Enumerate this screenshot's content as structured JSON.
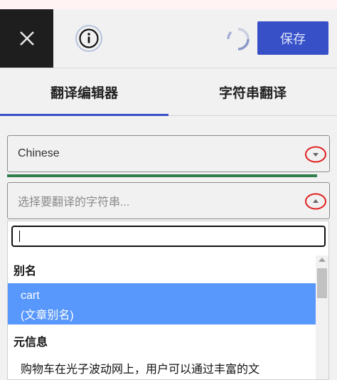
{
  "header": {
    "close_icon": "close-icon",
    "info_icon": "info-icon",
    "spinner_icon": "loading-spinner-icon",
    "save_label": "保存"
  },
  "tabs": [
    {
      "label": "翻译编辑器",
      "active": true
    },
    {
      "label": "字符串翻译",
      "active": false
    }
  ],
  "language_select": {
    "value": "Chinese"
  },
  "progress": {
    "fraction": 0.96,
    "color": "#2e7d4b"
  },
  "string_select": {
    "placeholder": "选择要翻译的字符串..."
  },
  "dropdown": {
    "search_value": "",
    "groups": [
      {
        "label": "别名",
        "options": [
          {
            "line1": "cart",
            "line2": "(文章别名)",
            "selected": true
          }
        ]
      },
      {
        "label": "元信息",
        "options": [
          {
            "text": "购物车在光子波动网上，用户可以通过丰富的文",
            "selected": false
          }
        ]
      }
    ]
  },
  "colors": {
    "accent": "#3750c8",
    "selected_option": "#5897fb",
    "highlight_circle": "#e02020"
  }
}
